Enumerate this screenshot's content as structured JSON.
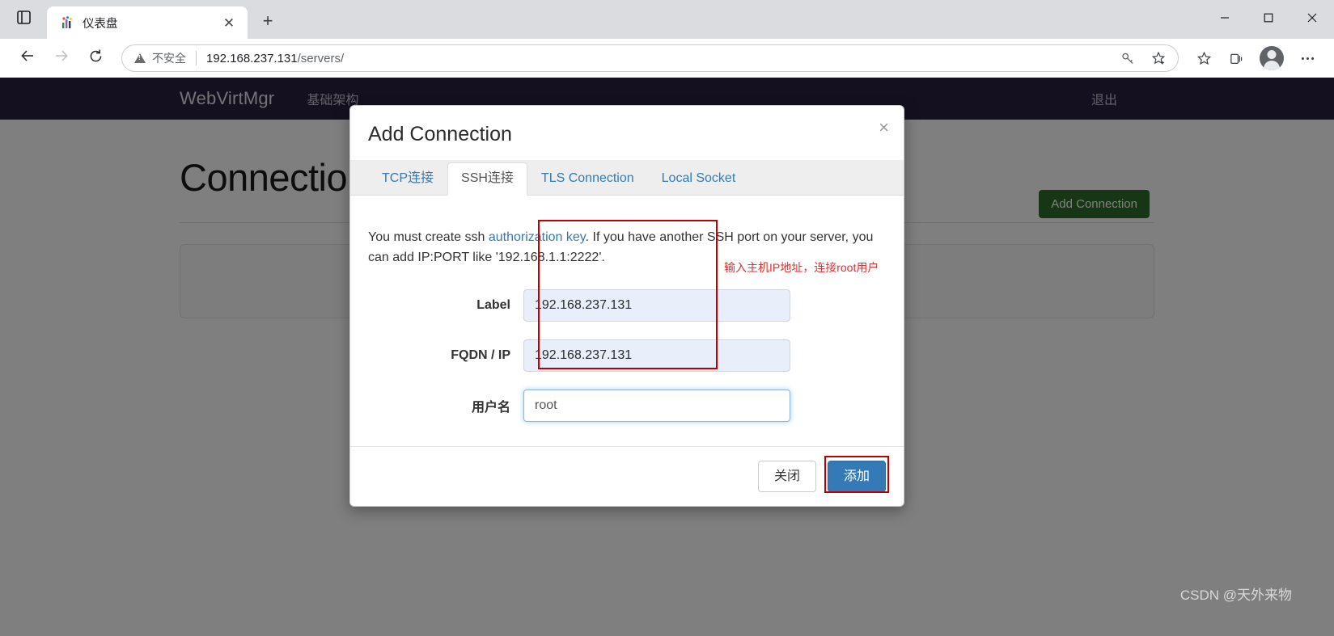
{
  "browser": {
    "tab": {
      "title": "仪表盘",
      "favicon_icon": "chart-favicon",
      "close_icon": "close-icon"
    },
    "new_tab_icon": "plus-icon",
    "tab_list_icon": "tab-list-icon",
    "window_controls": {
      "minimize_icon": "minimize-icon",
      "maximize_icon": "maximize-icon",
      "close_icon": "window-close-icon"
    },
    "nav": {
      "back_icon": "back-arrow-icon",
      "forward_icon": "forward-arrow-icon",
      "reload_icon": "reload-icon"
    },
    "omnibox": {
      "security_icon": "warning-triangle-icon",
      "security_text": "不安全",
      "url_host": "192.168.237.131",
      "url_path": "/servers/"
    },
    "toolbar_icons": [
      "key-icon",
      "favorite-add-icon",
      "favorites-icon",
      "collections-icon",
      "profile-avatar-icon",
      "more-settings-icon"
    ]
  },
  "page": {
    "navbar": {
      "brand": "WebVirtMgr",
      "links": [
        "基础架构"
      ],
      "logout": "退出"
    },
    "title": "Connections",
    "add_connection_button": "Add Connection"
  },
  "modal": {
    "title": "Add Connection",
    "close_icon": "modal-close-icon",
    "tabs": [
      {
        "label": "TCP连接",
        "active": false
      },
      {
        "label": "SSH连接",
        "active": true
      },
      {
        "label": "TLS Connection",
        "active": false
      },
      {
        "label": "Local Socket",
        "active": false
      }
    ],
    "help": {
      "before_link": "You must create ssh ",
      "link": "authorization key",
      "after_link": ". If you have another SSH port on your server, you can add IP:PORT like '192.168.1.1:2222'."
    },
    "fields": [
      {
        "label": "Label",
        "value": "192.168.237.131",
        "state": "autofilled"
      },
      {
        "label": "FQDN / IP",
        "value": "192.168.237.131",
        "state": "autofilled"
      },
      {
        "label": "用户名",
        "value": "root",
        "state": "focused"
      }
    ],
    "annotation": "输入主机IP地址，连接root用户",
    "buttons": {
      "close": "关闭",
      "submit": "添加"
    }
  },
  "watermark": "CSDN @天外来物",
  "colors": {
    "navbar": "#2b213f",
    "primary": "#337ab7",
    "success": "#2d6d2d",
    "annotation": "#e03030",
    "highlight_box": "#c00000",
    "autofill": "#e8effa"
  }
}
